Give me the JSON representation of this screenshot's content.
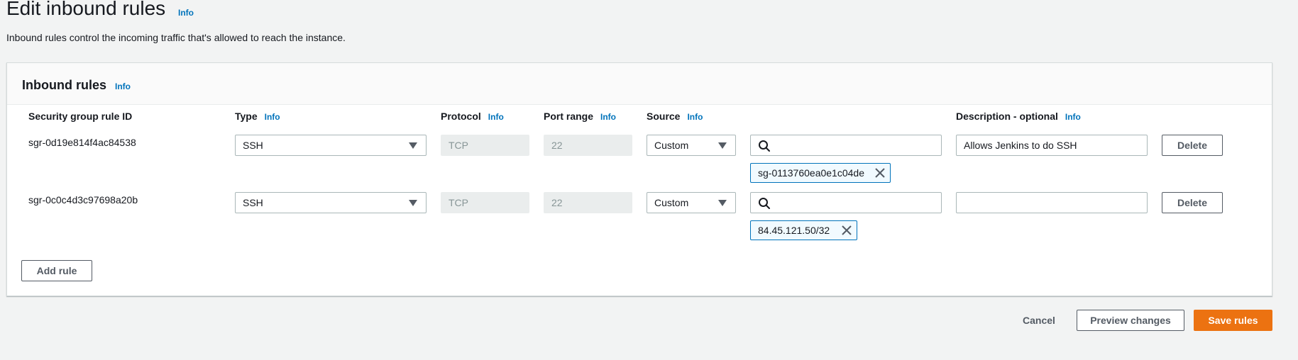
{
  "page": {
    "title": "Edit inbound rules",
    "title_info": "Info",
    "description": "Inbound rules control the incoming traffic that's allowed to reach the instance."
  },
  "panel": {
    "title": "Inbound rules",
    "info": "Info",
    "columns": {
      "rule_id": "Security group rule ID",
      "type": "Type",
      "protocol": "Protocol",
      "port_range": "Port range",
      "source": "Source",
      "description": "Description - optional",
      "info": "Info"
    },
    "rules": [
      {
        "id": "sgr-0d19e814f4ac84538",
        "type": "SSH",
        "protocol": "TCP",
        "port_range": "22",
        "source_type": "Custom",
        "source_search": "",
        "source_token": "sg-0113760ea0e1c04de",
        "description": "Allows Jenkins to do SSH",
        "delete_label": "Delete"
      },
      {
        "id": "sgr-0c0c4d3c97698a20b",
        "type": "SSH",
        "protocol": "TCP",
        "port_range": "22",
        "source_type": "Custom",
        "source_search": "",
        "source_token": "84.45.121.50/32",
        "description": "",
        "delete_label": "Delete"
      }
    ],
    "add_rule_label": "Add rule"
  },
  "footer": {
    "cancel_label": "Cancel",
    "preview_label": "Preview changes",
    "save_label": "Save rules"
  },
  "colors": {
    "primary": "#ec7211",
    "link": "#0073bb",
    "token_border": "#0073bb"
  }
}
